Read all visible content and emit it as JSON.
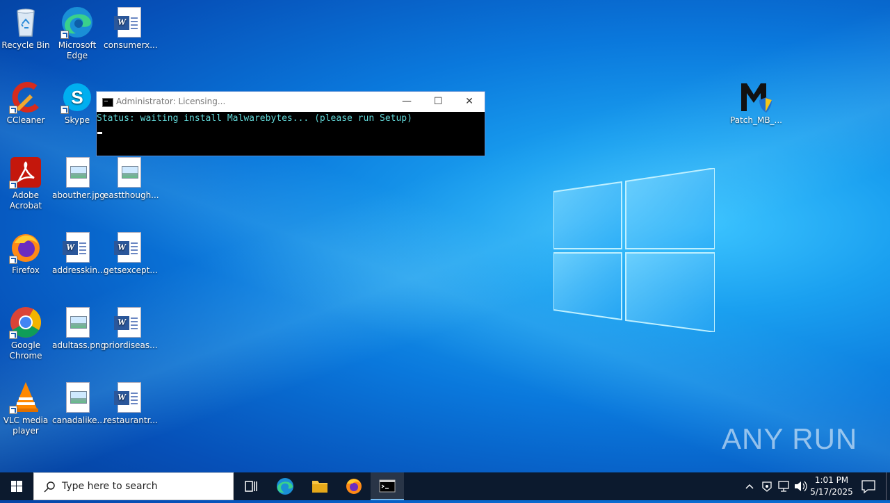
{
  "desktop_icons": [
    {
      "label": "Recycle Bin"
    },
    {
      "label": "Microsoft Edge"
    },
    {
      "label": "consumerx..."
    },
    {
      "label": "CCleaner"
    },
    {
      "label": "Skype"
    },
    {
      "label": "Adobe Acrobat"
    },
    {
      "label": "abouther.jpg"
    },
    {
      "label": "eastthough..."
    },
    {
      "label": "Firefox"
    },
    {
      "label": "addresskin..."
    },
    {
      "label": "getsexcept..."
    },
    {
      "label": "Google Chrome"
    },
    {
      "label": "adultass.png"
    },
    {
      "label": "priordiseas..."
    },
    {
      "label": "VLC media player"
    },
    {
      "label": "canadalike..."
    },
    {
      "label": "restaurantr..."
    },
    {
      "label": "Patch_MB_..."
    }
  ],
  "cmd_window": {
    "title": "Administrator:  Licensing...",
    "output_line": "Status: waiting install Malwarebytes... (please run Setup)",
    "minimize": "—",
    "maximize": "☐",
    "close": "✕"
  },
  "taskbar": {
    "search_placeholder": "Type here to search",
    "time": "1:01 PM",
    "date": "5/17/2025"
  },
  "watermark": "ANY RUN",
  "colors": {
    "terminal_text": "#61d6d6",
    "taskbar_bg": "#0c1a2e",
    "accent": "#76b9ed"
  }
}
